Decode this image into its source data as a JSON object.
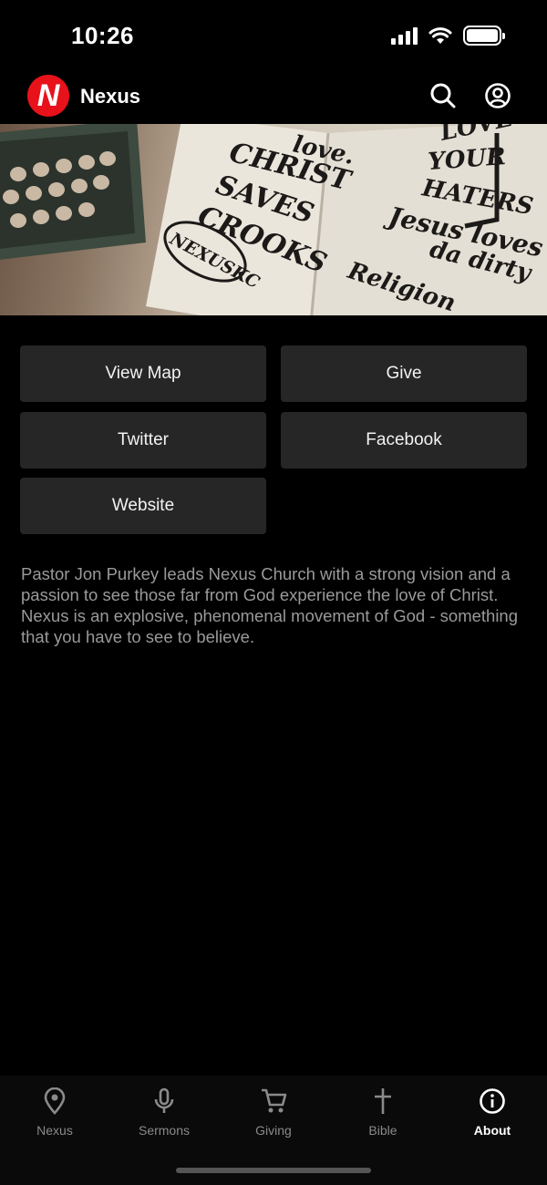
{
  "status": {
    "time": "10:26"
  },
  "header": {
    "logo_letter": "N",
    "title": "Nexus"
  },
  "hero": {
    "texts": [
      "love.",
      "CHRIST",
      "SAVES",
      "CROOKS",
      "NEXUSKC",
      "LOVE",
      "YOUR",
      "HATERS",
      "Jesus loves",
      "da dirty",
      "Religion"
    ]
  },
  "buttons": {
    "view_map": "View Map",
    "give": "Give",
    "twitter": "Twitter",
    "facebook": "Facebook",
    "website": "Website"
  },
  "description": "Pastor Jon Purkey leads Nexus Church with a strong vision and a passion to see those far from God experience the love of Christ. Nexus is an explosive, phenomenal movement of God - something that you have to see to believe.",
  "tabs": [
    {
      "label": "Nexus",
      "icon": "location-pin-icon"
    },
    {
      "label": "Sermons",
      "icon": "microphone-icon"
    },
    {
      "label": "Giving",
      "icon": "cart-icon"
    },
    {
      "label": "Bible",
      "icon": "cross-icon"
    },
    {
      "label": "About",
      "icon": "info-icon"
    }
  ],
  "colors": {
    "accent": "#e8121b",
    "background": "#000000",
    "button": "#262626"
  }
}
